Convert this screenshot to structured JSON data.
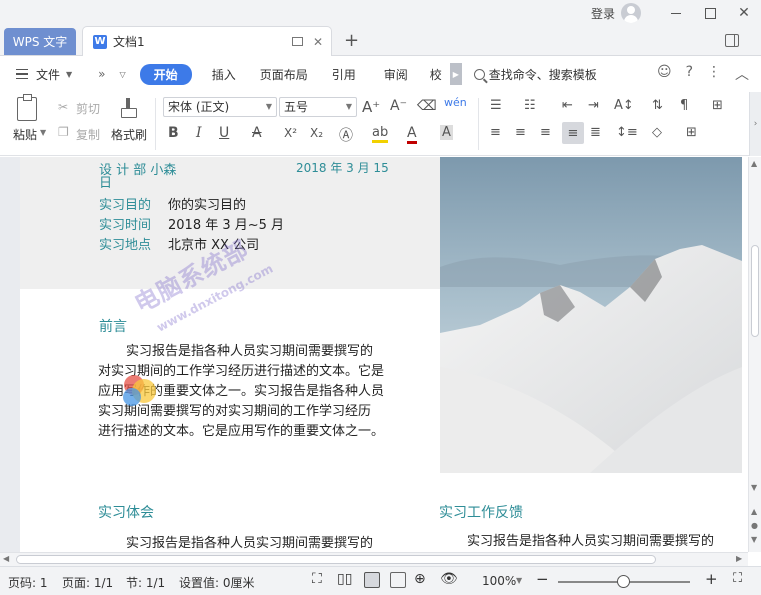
{
  "window": {
    "app_tab": "WPS 文字",
    "doc_tab": "文档1",
    "login": "登录",
    "new_tab": "+"
  },
  "menu": {
    "file": "文件",
    "more": "»",
    "tabs": [
      "开始",
      "插入",
      "页面布局",
      "引用",
      "审阅",
      "校"
    ],
    "search": "查找命令、搜索模板",
    "icons": [
      "comment-icon",
      "help-icon",
      "more-icon",
      "collapse-icon"
    ]
  },
  "ribbon": {
    "paste": "粘贴",
    "cut": "剪切",
    "copy": "复制",
    "format_painter": "格式刷",
    "font_name": "宋体 (正文)",
    "font_size": "五号",
    "bold": "B",
    "italic": "I",
    "underline": "U",
    "strike": "A",
    "superscript": "X²",
    "subscript": "X₂"
  },
  "document": {
    "header_line": "设 计 部  小森",
    "header_date": "2018 年 3 月 15",
    "header_wrap": "日",
    "fields": [
      {
        "label": "实习目的",
        "value": "你的实习目的"
      },
      {
        "label": "实习时间",
        "value": "2018 年 3 月~5 月"
      },
      {
        "label": "实习地点",
        "value": "北京市 XX 公司"
      }
    ],
    "preface_title": "前言",
    "preface_lines": [
      "实习报告是指各种人员实习期间需要撰写的",
      "对实习期间的工作学习经历进行描述的文本。它是",
      "应用写作的重要文体之一。实习报告是指各种人员",
      "实习期间需要撰写的对实习期间的工作学习经历",
      "进行描述的文本。它是应用写作的重要文体之一。"
    ],
    "section_left": "实习体会",
    "section_left_line": "实习报告是指各种人员实习期间需要撰写的",
    "section_right": "实习工作反馈",
    "section_right_line": "实习报告是指各种人员实习期间需要撰写的"
  },
  "watermark": {
    "main": "电脑系统部",
    "sub": "www.dnxitong.com"
  },
  "status": {
    "page_no": "页码: 1",
    "pages": "页面: 1/1",
    "section": "节: 1/1",
    "setting": "设置值: 0厘米",
    "zoom": "100%",
    "zoom_level": 0.5
  },
  "colors": {
    "accent": "#3d7ae8",
    "heading": "#2e8d97"
  }
}
